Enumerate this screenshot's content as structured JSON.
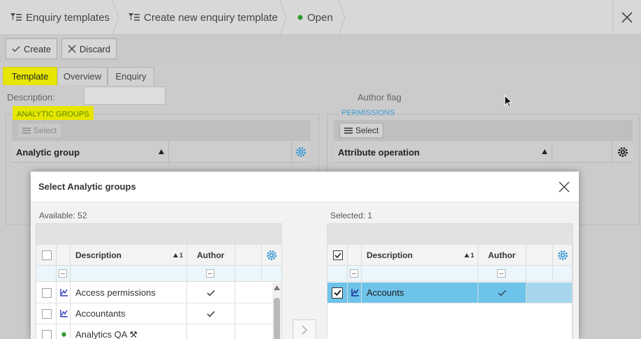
{
  "breadcrumb": {
    "items": [
      {
        "label": "Enquiry templates"
      },
      {
        "label": "Create new enquiry template"
      },
      {
        "label": "Open"
      }
    ]
  },
  "toolbar": {
    "create_label": "Create",
    "discard_label": "Discard"
  },
  "tabs": [
    {
      "label": "Template"
    },
    {
      "label": "Overview"
    },
    {
      "label": "Enquiry"
    }
  ],
  "form": {
    "description_label": "Description:",
    "description_value": "",
    "author_flag_label": "Author flag"
  },
  "analytic_groups": {
    "legend": "ANALYTIC GROUPS",
    "select_label": "Select",
    "column_header": "Analytic group"
  },
  "permissions": {
    "legend": "PERMISSIONS",
    "select_label": "Select",
    "column_header": "Attribute operation"
  },
  "dialog": {
    "title": "Select Analytic groups",
    "available_label": "Available: 52",
    "selected_label": "Selected: 1",
    "available_grid": {
      "headers": {
        "description": "Description",
        "sort_index": "1",
        "author": "Author"
      },
      "rows": [
        {
          "description": "Access permissions",
          "icon": "chart-icon",
          "author": true
        },
        {
          "description": "Accountants",
          "icon": "chart-icon",
          "author": true
        },
        {
          "description": "Analytics QA ⚒",
          "icon": "green-dot-icon",
          "author": false
        }
      ]
    },
    "selected_grid": {
      "headers": {
        "description": "Description",
        "sort_index": "1",
        "author": "Author"
      },
      "rows": [
        {
          "description": "Accounts",
          "icon": "chart-icon",
          "author": true,
          "checked": true
        }
      ]
    }
  },
  "colors": {
    "highlight": "#e6e600",
    "selected_row": "#6ec3ea",
    "accent_blue": "#3b9ad6",
    "status_green": "#2e9a2e"
  }
}
